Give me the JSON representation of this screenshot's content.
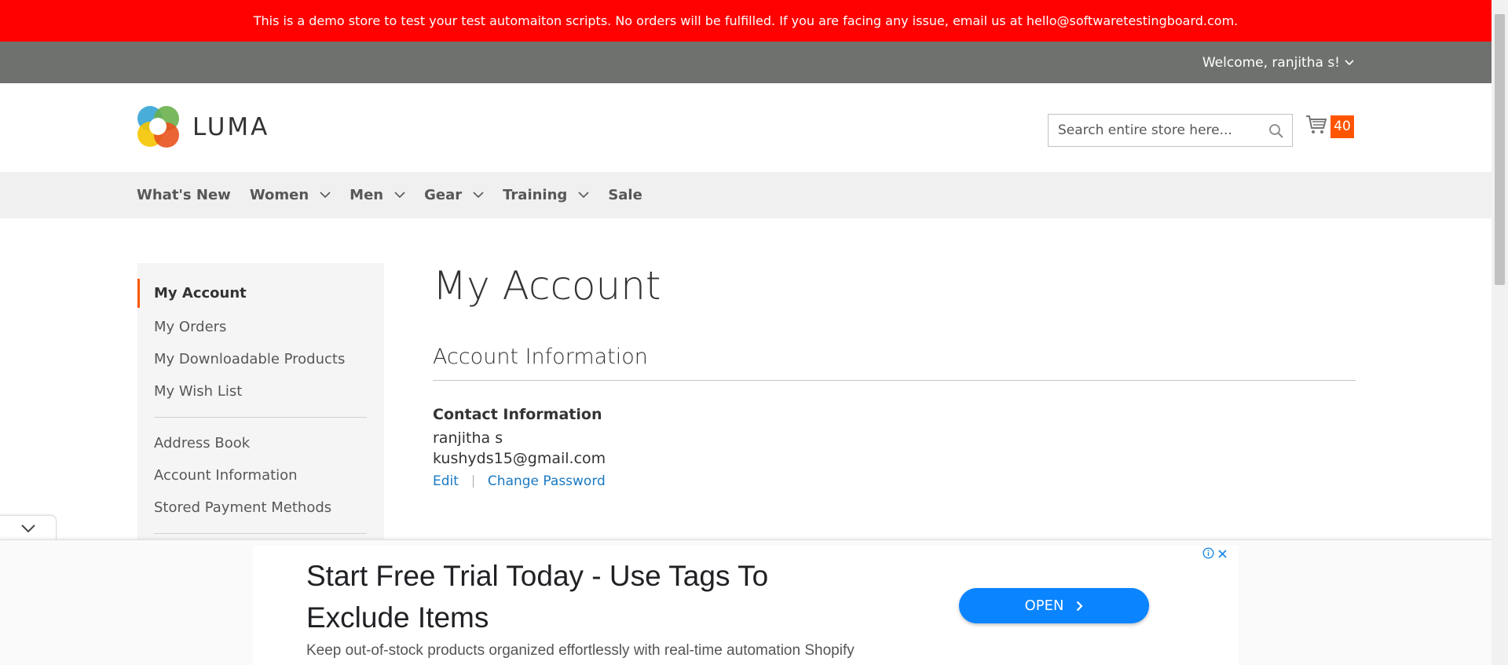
{
  "demo_notice": "This is a demo store to test your test automaiton scripts. No orders will be fulfilled. If you are facing any issue, email us at hello@softwaretestingboard.com.",
  "header_panel": {
    "welcome": "Welcome, ranjitha s!"
  },
  "logo": {
    "text": "LUMA"
  },
  "search": {
    "placeholder": "Search entire store here..."
  },
  "cart": {
    "count": "40"
  },
  "nav": {
    "items": [
      {
        "label": "What's New",
        "has_dropdown": false
      },
      {
        "label": "Women",
        "has_dropdown": true
      },
      {
        "label": "Men",
        "has_dropdown": true
      },
      {
        "label": "Gear",
        "has_dropdown": true
      },
      {
        "label": "Training",
        "has_dropdown": true
      },
      {
        "label": "Sale",
        "has_dropdown": false
      }
    ]
  },
  "sidebar": {
    "items": [
      {
        "label": "My Account",
        "active": true
      },
      {
        "label": "My Orders"
      },
      {
        "label": "My Downloadable Products"
      },
      {
        "label": "My Wish List"
      },
      {
        "label": "Address Book"
      },
      {
        "label": "Account Information"
      },
      {
        "label": "Stored Payment Methods"
      }
    ]
  },
  "main": {
    "title": "My Account",
    "section_title": "Account Information",
    "contact": {
      "title": "Contact Information",
      "name": "ranjitha s",
      "email": "kushyds15@gmail.com",
      "edit_label": "Edit",
      "change_password_label": "Change Password"
    }
  },
  "ad": {
    "headline": "Start Free Trial Today - Use Tags To Exclude Items",
    "description": "Keep out-of-stock products organized effortlessly with real-time automation Shopify",
    "button_label": "OPEN"
  },
  "colors": {
    "demo_bar": "#ff0101",
    "header_panel": "#6e716e",
    "accent": "#ff5501",
    "link": "#1979c3",
    "ad_button": "#0a84ff"
  }
}
